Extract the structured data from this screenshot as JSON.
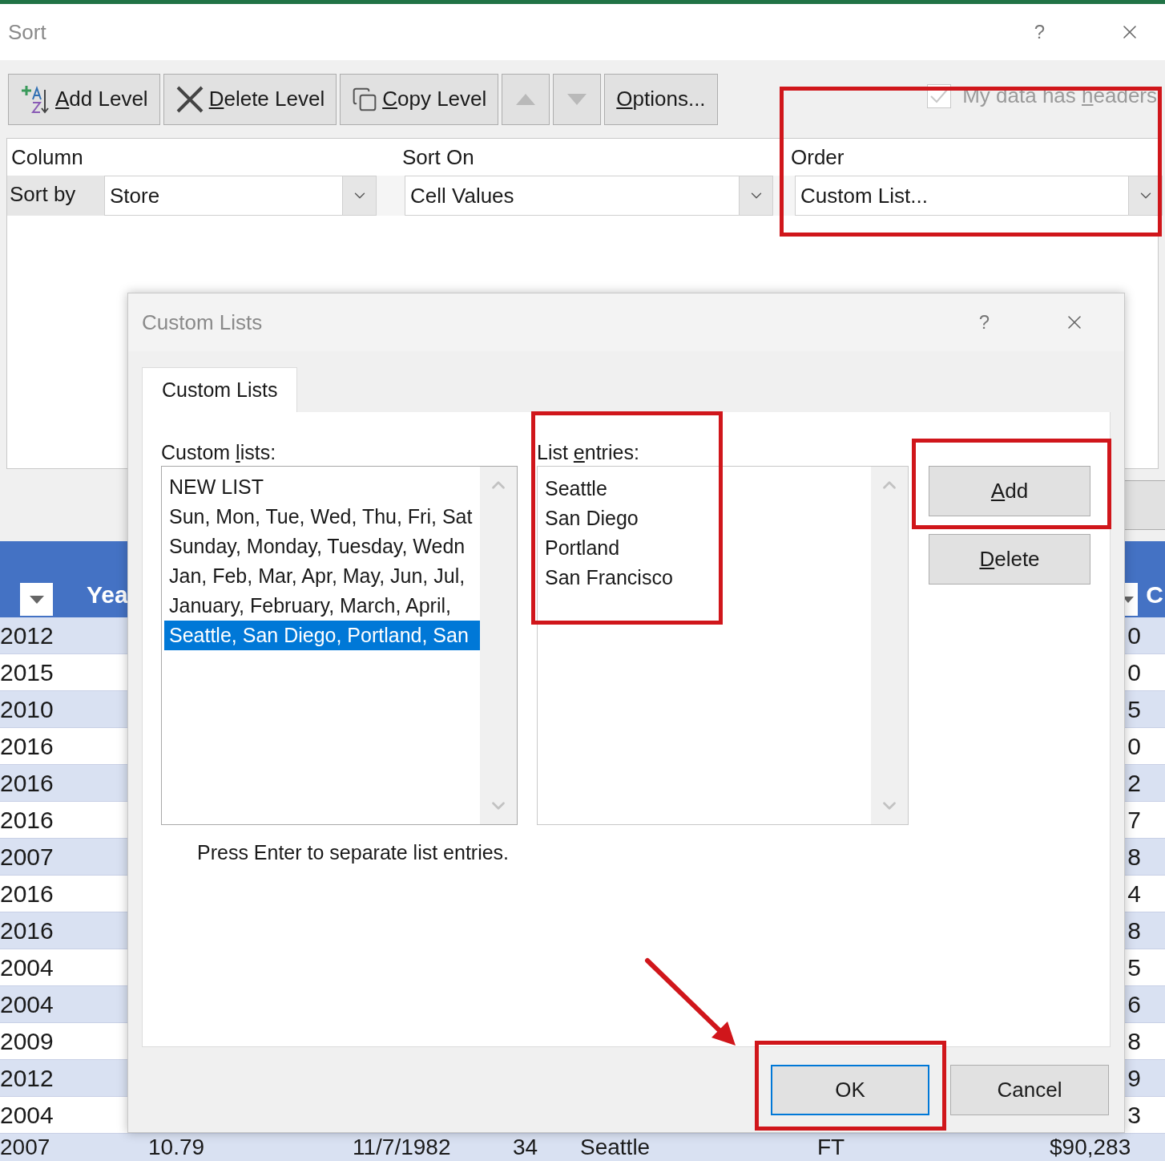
{
  "sort_dialog": {
    "title": "Sort",
    "help": "?",
    "toolbar": [
      {
        "kind": "add",
        "key": "A",
        "post": "dd Level",
        "disabled": false
      },
      {
        "kind": "delete",
        "key": "D",
        "post": "elete Level",
        "disabled": false
      },
      {
        "kind": "copy",
        "key": "C",
        "post": "opy Level",
        "disabled": false
      },
      {
        "kind": "up",
        "disabled": true
      },
      {
        "kind": "down",
        "disabled": true
      },
      {
        "kind": "options",
        "key": "O",
        "post": "ptions...",
        "disabled": false
      }
    ],
    "headers_checkbox": {
      "pre": "My data has ",
      "key": "h",
      "post": "eaders",
      "checked": true,
      "disabled": true
    },
    "columns": [
      "Column",
      "Sort On",
      "Order"
    ],
    "row": {
      "label": "Sort by",
      "column": "Store",
      "sort_on": "Cell Values",
      "order": "Custom List..."
    }
  },
  "sheet": {
    "headers": [
      "Yea",
      "C"
    ],
    "rows": [
      {
        "column_1": "2012",
        "column_n": "0"
      },
      {
        "column_1": "2015",
        "column_n": "0"
      },
      {
        "column_1": "2010",
        "column_n": "5"
      },
      {
        "column_1": "2016",
        "column_n": "0"
      },
      {
        "column_1": "2016",
        "column_n": "2"
      },
      {
        "column_1": "2016",
        "column_n": "7"
      },
      {
        "column_1": "2007",
        "column_n": "8"
      },
      {
        "column_1": "2016",
        "column_n": "4"
      },
      {
        "column_1": "2016",
        "column_n": "8"
      },
      {
        "column_1": "2004",
        "column_n": "5"
      },
      {
        "column_1": "2004",
        "column_n": "6"
      },
      {
        "column_1": "2009",
        "column_n": "8"
      },
      {
        "column_1": "2012",
        "column_n": "9"
      },
      {
        "column_1": "2004",
        "column_n": "3"
      }
    ],
    "last_row": [
      "2007",
      "10.79",
      "11/7/1982",
      "34",
      "Seattle",
      "FT",
      "$90,283"
    ]
  },
  "custom_lists_dialog": {
    "title": "Custom Lists",
    "help": "?",
    "tabs": [
      {
        "label": "Custom Lists",
        "selected": true
      }
    ],
    "lists_label": {
      "pre": "Custom ",
      "key": "l",
      "post": "ists:"
    },
    "lists": [
      {
        "label": "NEW LIST",
        "selected": false
      },
      {
        "label": "Sun, Mon, Tue, Wed, Thu, Fri, Sat",
        "selected": false
      },
      {
        "label": "Sunday, Monday, Tuesday, Wedn",
        "selected": false
      },
      {
        "label": "Jan, Feb, Mar, Apr, May, Jun, Jul,",
        "selected": false
      },
      {
        "label": "January, February, March, April,",
        "selected": false
      },
      {
        "label": "Seattle, San Diego, Portland, San",
        "selected": true
      }
    ],
    "entries_label": {
      "pre": "List ",
      "key": "e",
      "post": "ntries:"
    },
    "entries": [
      "Seattle",
      "San Diego",
      "Portland",
      "San Francisco"
    ],
    "side_buttons": [
      {
        "key": "A",
        "post": "dd"
      },
      {
        "key": "D",
        "post": "elete"
      }
    ],
    "hint": "Press Enter to separate list entries.",
    "footer_buttons": [
      {
        "label": "OK",
        "default": true
      },
      {
        "label": "Cancel",
        "default": false
      }
    ]
  }
}
